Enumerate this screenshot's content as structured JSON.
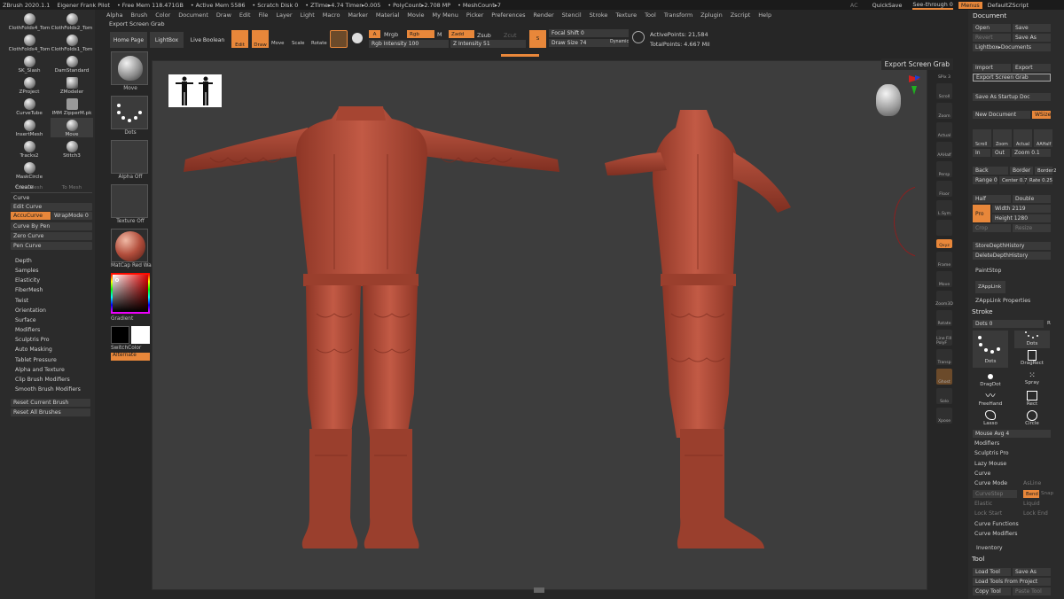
{
  "titlebar": {
    "app": "ZBrush 2020.1.1",
    "user": "Eigener Frank Pilot",
    "stats": [
      "• Free Mem 118.471GB",
      "• Active Mem 5586",
      "• Scratch Disk 0",
      "• ZTime▸4.74 Timer▸0.005",
      "• PolyCount▸2.708 MP",
      "• MeshCount▸7"
    ]
  },
  "topright": {
    "ac": "AC",
    "quicksave": "QuickSave",
    "seethrough": "See-through  0",
    "menus": "Menus",
    "script": "DefaultZScript"
  },
  "menubar": [
    "Alpha",
    "Brush",
    "Color",
    "Document",
    "Draw",
    "Edit",
    "File",
    "Layer",
    "Light",
    "Macro",
    "Marker",
    "Material",
    "Movie",
    "My Menu",
    "Picker",
    "Preferences",
    "Render",
    "Stencil",
    "Stroke",
    "Texture",
    "Tool",
    "Transform",
    "Zplugin",
    "Zscript",
    "Help"
  ],
  "toolbar": {
    "export_label": "Export Screen Grab",
    "home": "Home Page",
    "lightbox": "LightBox",
    "liveboolean": "Live Boolean",
    "edit": "Edit",
    "draw": "Draw",
    "move": "Move",
    "scale": "Scale",
    "rotate": "Rotate",
    "a": "A",
    "mrgb": "Mrgb",
    "rgb": "Rgb",
    "m": "M",
    "rgb_intensity": "Rgb Intensity 100",
    "zadd": "Zadd",
    "zsub": "Zsub",
    "zcut": "Zcut",
    "z_intensity": "Z Intensity 51",
    "focal_shift": "Focal Shift 0",
    "draw_size": "Draw Size 74",
    "dynamic": "Dynamic",
    "active_points": "ActivePoints: 21,584",
    "total_points": "TotalPoints: 4.667 Mil"
  },
  "left_tools": [
    {
      "label": "ClothFolds4_Tom",
      "num": ""
    },
    {
      "label": "ClothFolds2_Tom",
      "num": ""
    },
    {
      "label": "ClothFolds4_Tom",
      "num": ""
    },
    {
      "label": "ClothFolds1_Tom",
      "num": ""
    },
    {
      "label": "SK_Slash",
      "num": ""
    },
    {
      "label": "DamStandard",
      "num": ""
    },
    {
      "label": "ZProject",
      "num": ""
    },
    {
      "label": "ZModeler",
      "num": "3"
    },
    {
      "label": "CurveTube",
      "num": ""
    },
    {
      "label": "IMM ZipperM.pk",
      "num": "7"
    },
    {
      "label": "InsertMesh",
      "num": "1"
    },
    {
      "label": "Move",
      "num": ""
    },
    {
      "label": "Tracks2",
      "num": ""
    },
    {
      "label": "Stitch3",
      "num": ""
    },
    {
      "label": "MaskCircle",
      "num": ""
    }
  ],
  "left_dim": [
    "From Mesh",
    "To Mesh"
  ],
  "left_curve": {
    "create": "Create",
    "curve": "Curve",
    "edit_curve": "Edit Curve",
    "accucurve": "AccuCurve",
    "wrapmode": "WrapMode 0",
    "curve_by_pen": "Curve By Pen",
    "zero_curve": "Zero Curve",
    "pen_curve": "Pen Curve"
  },
  "left_menu": [
    "Depth",
    "Samples",
    "Elasticity",
    "FiberMesh",
    "Twist",
    "Orientation",
    "Surface",
    "Modifiers",
    "Sculptris Pro",
    "Auto Masking",
    "Tablet Pressure",
    "Alpha and Texture",
    "Clip Brush Modifiers",
    "Smooth Brush Modifiers"
  ],
  "left_reset": [
    "Reset Current Brush",
    "Reset All Brushes"
  ],
  "col2": {
    "move": "Move",
    "dots": "Dots",
    "alpha": "Alpha Off",
    "texture": "Texture Off",
    "matcap": "MatCap Red Wax",
    "gradient": "Gradient",
    "switchcolor": "SwitchColor",
    "alternate": "Alternate"
  },
  "canvas": {
    "tooltip": "Export Screen Grab"
  },
  "right_icons": [
    {
      "name": "spix",
      "label": "SPix 3"
    },
    {
      "name": "scroll",
      "label": "Scroll"
    },
    {
      "name": "zoom",
      "label": "Zoom"
    },
    {
      "name": "actual",
      "label": "Actual"
    },
    {
      "name": "aahalf",
      "label": "AAHalf"
    },
    {
      "name": "persp",
      "label": "Persp"
    },
    {
      "name": "floor",
      "label": "Floor"
    },
    {
      "name": "lsym",
      "label": "L.Sym"
    },
    {
      "name": "lock",
      "label": ""
    },
    {
      "name": "qxyz",
      "label": "Qxyz"
    },
    {
      "name": "frame",
      "label": "Frame"
    },
    {
      "name": "move",
      "label": "Move"
    },
    {
      "name": "zoom3d",
      "label": "Zoom3D"
    },
    {
      "name": "rotate",
      "label": "Rotate"
    },
    {
      "name": "linefill",
      "label": "Line Fill PolyF"
    },
    {
      "name": "transp",
      "label": "Transp"
    },
    {
      "name": "ghost",
      "label": "Ghost"
    },
    {
      "name": "solo",
      "label": "Solo"
    },
    {
      "name": "xpose",
      "label": "Xpose"
    }
  ],
  "right_panel": {
    "document": "Document",
    "open": "Open",
    "save": "Save",
    "revert": "Revert",
    "save_as": "Save As",
    "lightbox_docs": "Lightbox▸Documents",
    "import": "Import",
    "export": "Export",
    "export_grab": "Export Screen Grab",
    "save_startup": "Save As Startup Doc",
    "new_document": "New Document",
    "wsize": "WSize",
    "scroll": "Scroll",
    "zoom": "Zoom",
    "actual": "Actual",
    "aahalf": "AAHalf",
    "in": "In",
    "out": "Out",
    "zoom_val": "Zoom 0.1",
    "back": "Back",
    "border": "Border",
    "border2": "Border2",
    "range": "Range 0",
    "center": "Center 0.7",
    "rate": "Rate 0.25",
    "half": "Half",
    "double": "Double",
    "pro": "Pro",
    "width": "Width 2119",
    "height": "Height 1280",
    "crop": "Crop",
    "resize": "Resize",
    "store_depth": "StoreDepthHistory",
    "delete_depth": "DeleteDepthHistory",
    "paintstop": "PaintStop",
    "zapplink": "ZAppLink",
    "zapplink_props": "ZAppLink Properties",
    "stroke": "Stroke",
    "dots_val": "Dots 0",
    "r": "R",
    "dots_big": "Dots",
    "dots_small": "Dots",
    "dragrect": "DragRect",
    "dragdot": "DragDot",
    "spray": "Spray",
    "freehand": "FreeHand",
    "rect": "Rect",
    "lasso": "Lasso",
    "circle": "Circle",
    "mouse_avg": "Mouse Avg 4",
    "modifiers": "Modifiers",
    "sculptris": "Sculptris Pro",
    "lazy": "Lazy Mouse",
    "curve": "Curve",
    "curve_mode": "Curve Mode",
    "asline": "AsLine",
    "curvestep": "CurveStep",
    "bend": "Bend",
    "snap": "Snap",
    "elastic": "Elastic",
    "liquid": "Liquid",
    "lock_start": "Lock Start",
    "lock_end": "Lock End",
    "curve_functions": "Curve Functions",
    "curve_modifiers": "Curve Modifiers",
    "inventory": "Inventory",
    "tool": "Tool",
    "load_tool": "Load Tool",
    "save_as2": "Save As",
    "load_from_project": "Load Tools From Project",
    "copy_tool": "Copy Tool",
    "paste_tool": "Paste Tool"
  },
  "colors": {
    "accent": "#e8873a",
    "clay": "#b24e3c",
    "canvas": "#3d3d3d",
    "panel": "#2b2b2b"
  }
}
